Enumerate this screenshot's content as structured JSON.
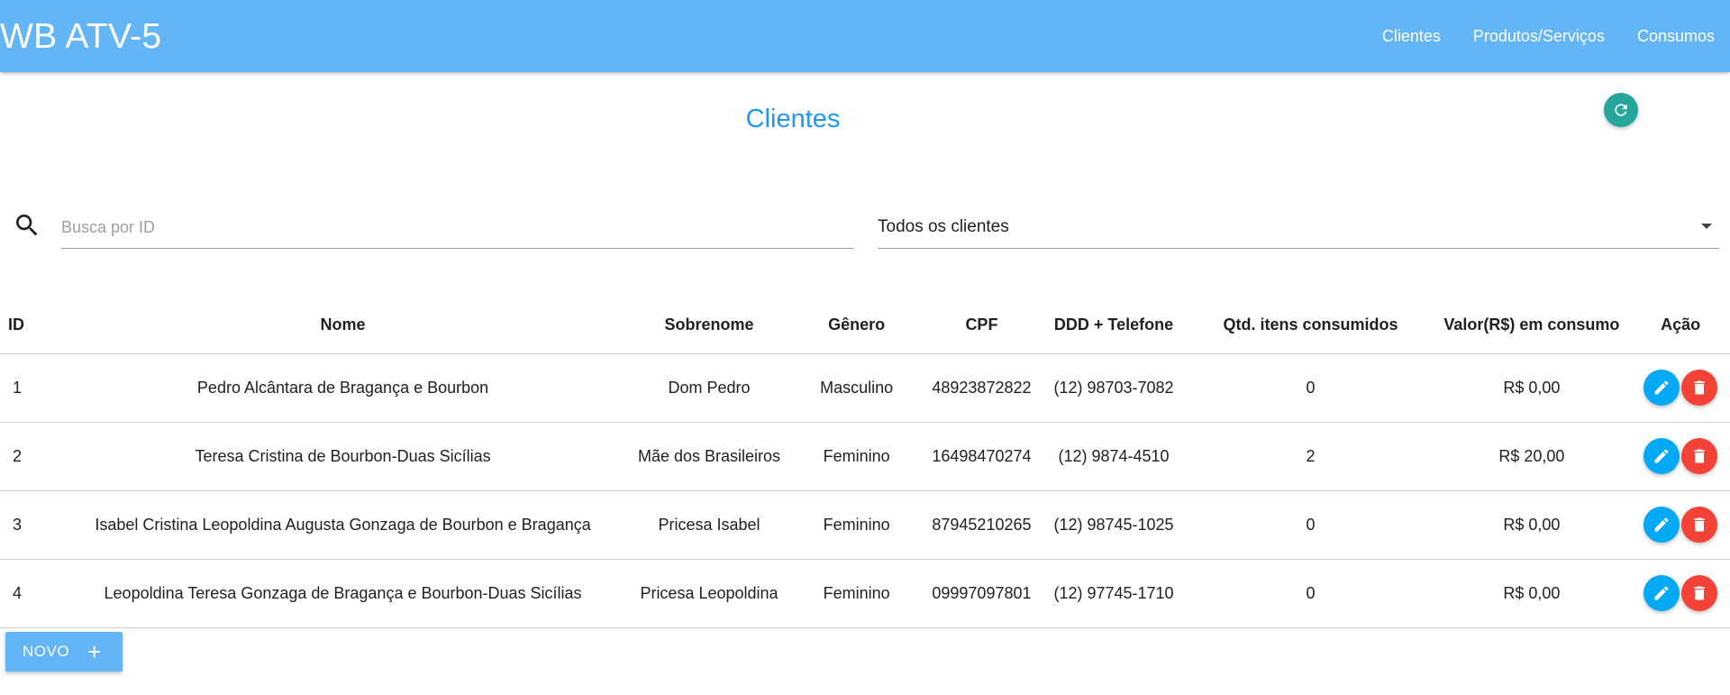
{
  "app": {
    "brand": "WB ATV-5"
  },
  "nav": {
    "items": [
      "Clientes",
      "Produtos/Serviços",
      "Consumos"
    ]
  },
  "page": {
    "title": "Clientes",
    "refresh_icon": "refresh-icon"
  },
  "search": {
    "placeholder": "Busca por ID",
    "value": ""
  },
  "filter": {
    "selected": "Todos os clientes"
  },
  "table": {
    "headers": [
      "ID",
      "Nome",
      "Sobrenome",
      "Gênero",
      "CPF",
      "DDD + Telefone",
      "Qtd. itens consumidos",
      "Valor(R$) em consumo",
      "Ação"
    ],
    "rows": [
      {
        "id": "1",
        "nome": "Pedro Alcântara de Bragança e Bourbon",
        "sobrenome": "Dom Pedro",
        "genero": "Masculino",
        "cpf": "48923872822",
        "telefone": "(12) 98703-7082",
        "qtd": "0",
        "valor": "R$ 0,00"
      },
      {
        "id": "2",
        "nome": "Teresa Cristina de Bourbon-Duas Sicílias",
        "sobrenome": "Mãe dos Brasileiros",
        "genero": "Feminino",
        "cpf": "16498470274",
        "telefone": "(12) 9874-4510",
        "qtd": "2",
        "valor": "R$ 20,00"
      },
      {
        "id": "3",
        "nome": "Isabel Cristina Leopoldina Augusta Gonzaga de Bourbon e Bragança",
        "sobrenome": "Pricesa Isabel",
        "genero": "Feminino",
        "cpf": "87945210265",
        "telefone": "(12) 98745-1025",
        "qtd": "0",
        "valor": "R$ 0,00"
      },
      {
        "id": "4",
        "nome": "Leopoldina Teresa Gonzaga de Bragança e Bourbon-Duas Sicílias",
        "sobrenome": "Pricesa Leopoldina",
        "genero": "Feminino",
        "cpf": "09997097801",
        "telefone": "(12) 97745-1710",
        "qtd": "0",
        "valor": "R$ 0,00"
      }
    ]
  },
  "actions": {
    "new_label": "NOVO",
    "new_icon": "+"
  },
  "colors": {
    "navbar": "#64b5f6",
    "title": "#2196f3",
    "refresh": "#26a69a",
    "edit": "#03a9f4",
    "delete": "#f44336"
  }
}
